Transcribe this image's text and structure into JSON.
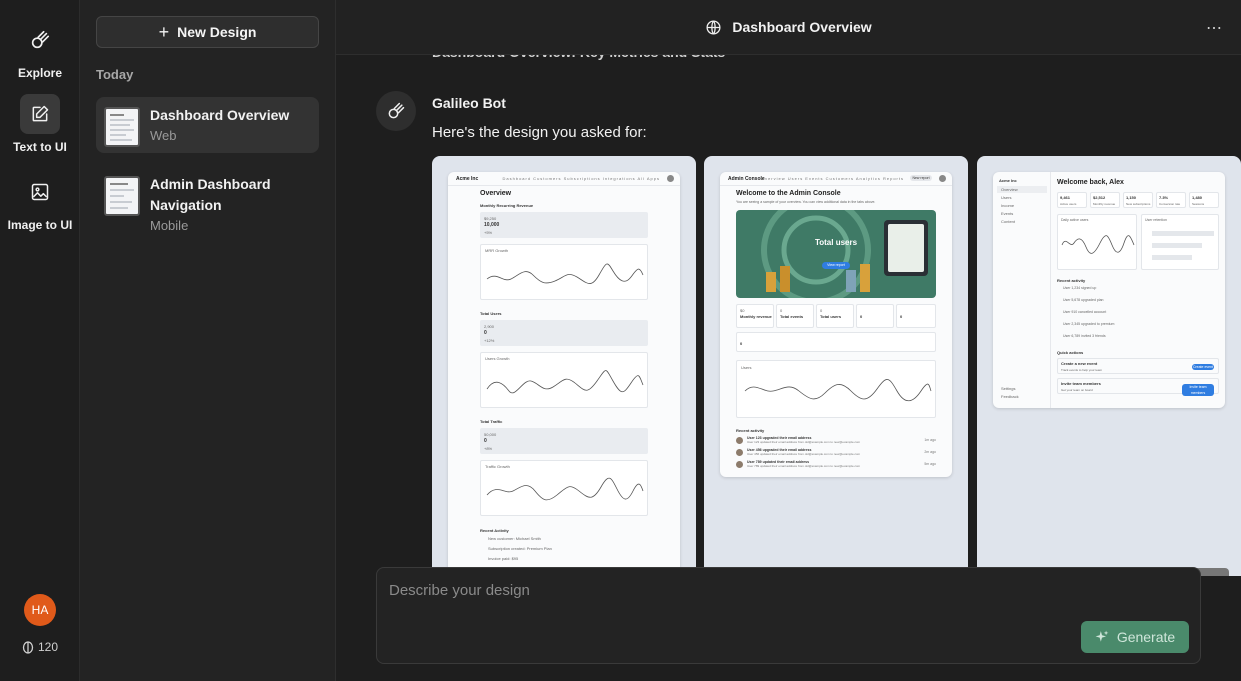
{
  "rail": {
    "items": [
      {
        "label": "Explore",
        "icon": "explore-icon"
      },
      {
        "label": "Text to UI",
        "icon": "edit-icon"
      },
      {
        "label": "Image to UI",
        "icon": "image-icon"
      }
    ],
    "user_initials": "HA",
    "credits": "120"
  },
  "panel": {
    "new_design_label": "New Design",
    "section": "Today",
    "history": [
      {
        "title": "Dashboard Overview",
        "platform": "Web"
      },
      {
        "title": "Admin Dashboard Navigation",
        "platform": "Mobile"
      }
    ]
  },
  "header": {
    "title": "Dashboard Overview",
    "more": "⋯"
  },
  "chat": {
    "previous_prompt": "Dashboard Overview: Key Metrics and Stats",
    "bot_name": "Galileo Bot",
    "bot_message": "Here's the design you asked for:"
  },
  "preview1": {
    "brand": "Acme Inc",
    "nav_links": "Dashboard  Customers  Subscriptions  Integrations  All Apps",
    "title": "Overview",
    "sections": [
      {
        "label": "Monthly Recurring Revenue",
        "small": "$9,250",
        "value": "10,000",
        "delta": "+5%",
        "chart": "MRR Growth"
      },
      {
        "label": "Total Users",
        "small": "2,900",
        "value": "0",
        "delta": "+12%",
        "chart": "Users Growth"
      },
      {
        "label": "Total Traffic",
        "small": "50,000",
        "value": "0",
        "delta": "+8%",
        "chart": "Traffic Growth"
      }
    ],
    "recent_title": "Recent Activity",
    "recent": [
      "New customer: Michael Smith",
      "Subscription created: Premium Plan",
      "Invoice paid: $95"
    ]
  },
  "preview2": {
    "brand": "Admin Console",
    "nav_links": "Overview  Users  Events  Customers  Analytics  Reports",
    "nav_button": "New report",
    "title": "Welcome to the Admin Console",
    "subtitle": "You are seeing a sample of your overview. You can view additional data in the tabs above.",
    "hero_title": "Total users",
    "hero_button": "View report",
    "stats": [
      {
        "value": "$0",
        "label": "Monthly revenue"
      },
      {
        "value": "0",
        "label": "Total events"
      },
      {
        "value": "0",
        "label": "Total users"
      },
      {
        "value": "0",
        "label": ""
      },
      {
        "value": "0",
        "label": ""
      }
    ],
    "extra_stat": "0",
    "chart_label": "Users",
    "recent_title": "Recent activity",
    "recent": [
      {
        "title": "User 123 upgraded their email address",
        "sub": "User 123 updated their email address from old@example.com to new@example.com",
        "time": "1m ago"
      },
      {
        "title": "User 456 upgraded their email address",
        "sub": "User 456 updated their email address from old@example.com to new@example.com",
        "time": "2m ago"
      },
      {
        "title": "User 789 updated their email address",
        "sub": "User 789 updated their email address from old@example.com to new@example.com",
        "time": "5m ago"
      }
    ]
  },
  "preview3": {
    "brand": "Acme Inc",
    "sidebar": [
      "Overview",
      "Users",
      "Income",
      "Events",
      "Content"
    ],
    "sidebar_bottom": [
      "Settings",
      "Feedback"
    ],
    "title": "Welcome back, Alex",
    "stats": [
      {
        "value": "9,461",
        "label": "Active users"
      },
      {
        "value": "$2,512",
        "label": "Monthly revenue"
      },
      {
        "value": "1,150",
        "label": "New subscriptions"
      },
      {
        "value": "7.3%",
        "label": "Conversion rate"
      },
      {
        "value": "1,480",
        "label": "Sessions"
      }
    ],
    "chart1": "Daily active users",
    "chart2": "User retention",
    "recent_title": "Recent activity",
    "recent": [
      "User 1,234 signed up",
      "User 5,678 upgraded plan",
      "User 910 cancelled account",
      "User 2,345 upgraded to premium",
      "User 6,789 invited 3 friends"
    ],
    "quick_title": "Quick actions",
    "actions": [
      {
        "title": "Create a new event",
        "sub": "Track events to help your team",
        "button": "Create event"
      },
      {
        "title": "Invite team members",
        "sub": "Get your team on board",
        "button": "Invite team members"
      }
    ]
  },
  "composer": {
    "placeholder": "Describe your design",
    "generate_label": "Generate"
  },
  "colors": {
    "background": "#1e1e1e",
    "panel": "#232323",
    "accent": "#4a8a6b",
    "avatar": "#e05a1a",
    "preview_link": "#2f7de1"
  }
}
